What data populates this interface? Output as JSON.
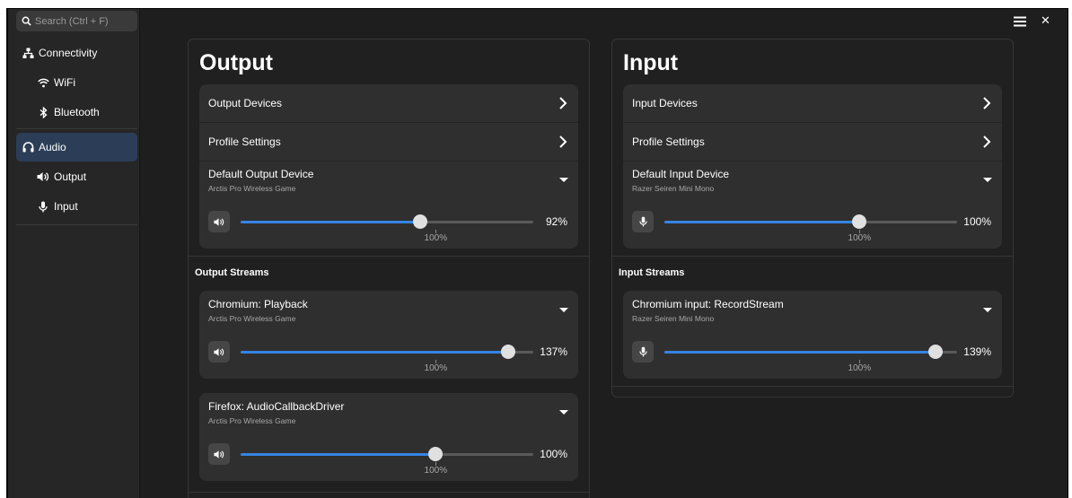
{
  "search": {
    "placeholder": "Search (Ctrl + F)"
  },
  "sidebar": {
    "items": [
      {
        "label": "Connectivity"
      },
      {
        "label": "WiFi"
      },
      {
        "label": "Bluetooth"
      },
      {
        "label": "Audio"
      },
      {
        "label": "Output"
      },
      {
        "label": "Input"
      }
    ]
  },
  "output": {
    "title": "Output",
    "devices_label": "Output Devices",
    "profile_label": "Profile Settings",
    "default_title": "Default Output Device",
    "default_device": "Arctis Pro Wireless Game",
    "default_volume": "92%",
    "default_volume_value": 0.92,
    "mark_label": "100%",
    "streams_title": "Output Streams",
    "streams": [
      {
        "name": "Chromium: Playback",
        "device": "Arctis Pro Wireless Game",
        "volume": "137%",
        "value": 1.37
      },
      {
        "name": "Firefox: AudioCallbackDriver",
        "device": "Arctis Pro Wireless Game",
        "volume": "100%",
        "value": 1.0
      }
    ]
  },
  "input": {
    "title": "Input",
    "devices_label": "Input Devices",
    "profile_label": "Profile Settings",
    "default_title": "Default Input Device",
    "default_device": "Razer Seiren Mini Mono",
    "default_volume": "100%",
    "default_volume_value": 1.0,
    "mark_label": "100%",
    "streams_title": "Input Streams",
    "streams": [
      {
        "name": "Chromium input: RecordStream",
        "device": "Razer Seiren Mini Mono",
        "volume": "139%",
        "value": 1.39
      }
    ]
  }
}
